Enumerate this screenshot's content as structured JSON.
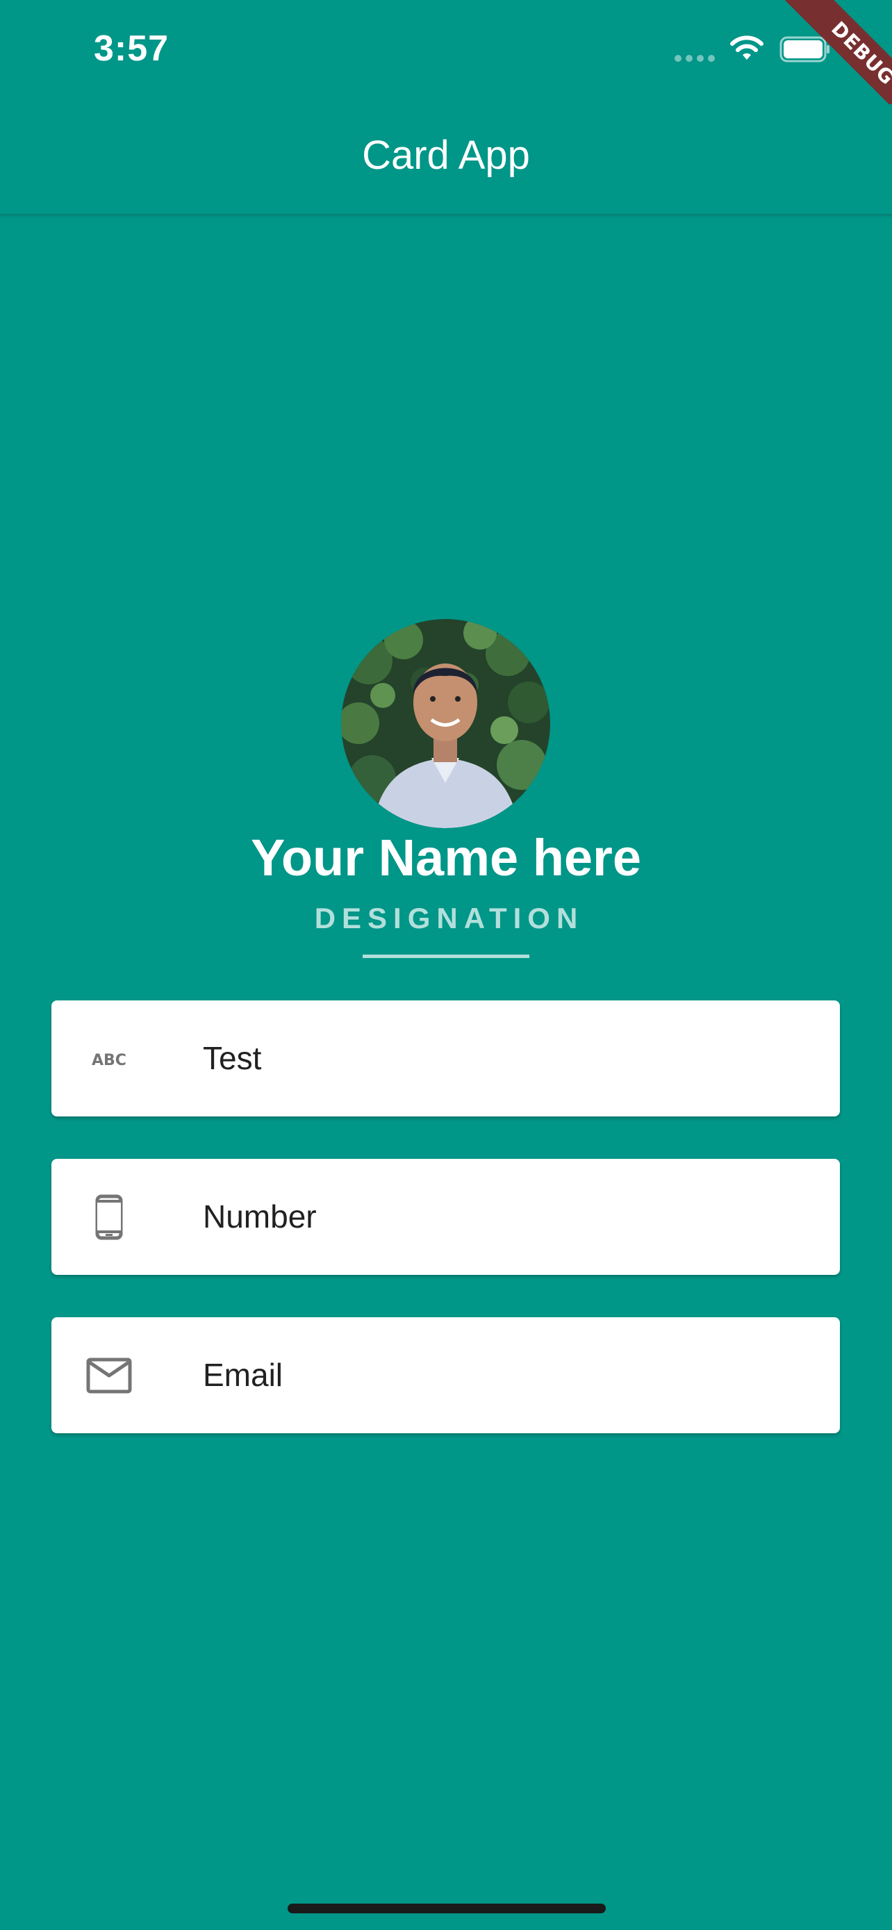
{
  "status_bar": {
    "time": "3:57"
  },
  "debug_banner": {
    "label": "DEBUG"
  },
  "app_bar": {
    "title": "Card App"
  },
  "profile": {
    "avatar_icon": "profile-photo",
    "name": "Your Name here",
    "designation": "DESIGNATION"
  },
  "cards": [
    {
      "icon": "abc-icon",
      "text": "Test"
    },
    {
      "icon": "phone-icon",
      "text": "Number"
    },
    {
      "icon": "email-icon",
      "text": "Email"
    }
  ],
  "colors": {
    "background": "#009688",
    "designation": "#b2dfdb",
    "card": "#ffffff",
    "icon": "#757575",
    "debug": "#882222"
  }
}
